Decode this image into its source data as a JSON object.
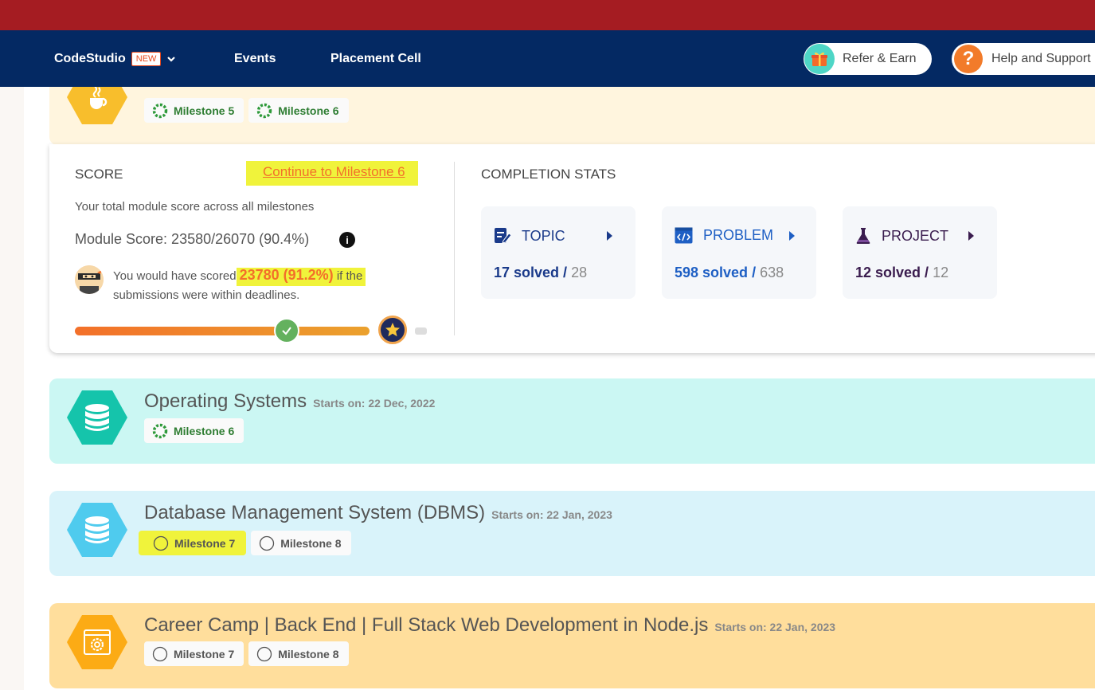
{
  "nav": {
    "codestudio": "CodeStudio",
    "new_badge": "NEW",
    "events": "Events",
    "placement": "Placement Cell",
    "refer": "Refer & Earn",
    "help": "Help and Support"
  },
  "top_card": {
    "milestones": [
      "Milestone 5",
      "Milestone 6"
    ]
  },
  "score": {
    "heading": "SCORE",
    "continue_link": "Continue to Milestone 6",
    "desc": "Your total module score across all milestones",
    "module_score": "Module Score: 23580/26070 (90.4%)",
    "would_prefix": "You would have scored",
    "would_value": "23780 (91.2%)",
    "would_mid": "if the",
    "would_suffix": "submissions were within deadlines.",
    "progress": 0.84
  },
  "completion": {
    "heading": "COMPLETION STATS",
    "stats": [
      {
        "label": "TOPIC",
        "solved": "17 solved",
        "total": "28",
        "color": "#1a3a8a"
      },
      {
        "label": "PROBLEM",
        "solved": "598 solved",
        "total": "638",
        "color": "#1e5fc4"
      },
      {
        "label": "PROJECT",
        "solved": "12 solved",
        "total": "12",
        "color": "#3a1c4e"
      }
    ]
  },
  "courses": [
    {
      "title": "Operating Systems",
      "starts": "Starts on: 22 Dec, 2022",
      "milestones": [
        "Milestone 6"
      ]
    },
    {
      "title": "Database Management System (DBMS)",
      "starts": "Starts on: 22 Jan, 2023",
      "milestones": [
        "Milestone 7",
        "Milestone 8"
      ]
    },
    {
      "title": "Career Camp | Back End | Full Stack Web Development in Node.js",
      "starts": "Starts on: 22 Jan, 2023",
      "milestones": [
        "Milestone 7",
        "Milestone 8"
      ]
    }
  ],
  "colors": {
    "topstrip": "#a51c22",
    "navbar": "#042963",
    "highlight": "#f0f33b",
    "orange": "#f3702a"
  }
}
